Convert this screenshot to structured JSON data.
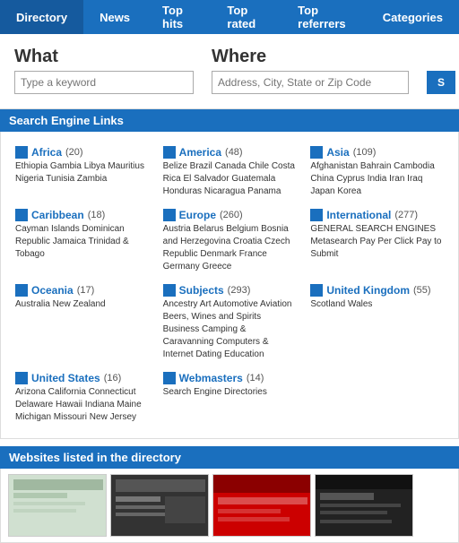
{
  "nav": {
    "items": [
      {
        "label": "Directory",
        "active": true
      },
      {
        "label": "News",
        "active": false
      },
      {
        "label": "Top hits",
        "active": false
      },
      {
        "label": "Top rated",
        "active": false
      },
      {
        "label": "Top referrers",
        "active": false
      },
      {
        "label": "Categories",
        "active": false
      }
    ]
  },
  "search": {
    "what_label": "What",
    "what_placeholder": "Type a keyword",
    "where_label": "Where",
    "where_placeholder": "Address, City, State or Zip Code",
    "button_label": "S"
  },
  "search_engine_links": {
    "header": "Search Engine Links",
    "categories": [
      {
        "name": "Africa",
        "count": "(20)",
        "desc": "Ethiopia Gambia Libya Mauritius Nigeria Tunisia Zambia"
      },
      {
        "name": "America",
        "count": "(48)",
        "desc": "Belize Brazil Canada Chile Costa Rica El Salvador Guatemala Honduras Nicaragua Panama"
      },
      {
        "name": "Asia",
        "count": "(109)",
        "desc": "Afghanistan Bahrain Cambodia China Cyprus India Iran Iraq Japan Korea"
      },
      {
        "name": "Caribbean",
        "count": "(18)",
        "desc": "Cayman Islands Dominican Republic Jamaica Trinidad & Tobago"
      },
      {
        "name": "Europe",
        "count": "(260)",
        "desc": "Austria Belarus Belgium Bosnia and Herzegovina Croatia Czech Republic Denmark France Germany Greece"
      },
      {
        "name": "International",
        "count": "(277)",
        "desc": "GENERAL SEARCH ENGINES Metasearch Pay Per Click Pay to Submit"
      },
      {
        "name": "Oceania",
        "count": "(17)",
        "desc": "Australia New Zealand"
      },
      {
        "name": "Subjects",
        "count": "(293)",
        "desc": "Ancestry Art Automotive Aviation Beers, Wines and Spirits Business Camping & Caravanning Computers & Internet Dating Education"
      },
      {
        "name": "United Kingdom",
        "count": "(55)",
        "desc": "Scotland Wales"
      },
      {
        "name": "United States",
        "count": "(16)",
        "desc": "Arizona California Connecticut Delaware Hawaii Indiana Maine Michigan Missouri New Jersey"
      },
      {
        "name": "Webmasters",
        "count": "(14)",
        "desc": "Search Engine Directories"
      },
      {
        "name": "",
        "count": "",
        "desc": ""
      }
    ]
  },
  "websites_listed": {
    "header": "Websites listed in the directory"
  }
}
